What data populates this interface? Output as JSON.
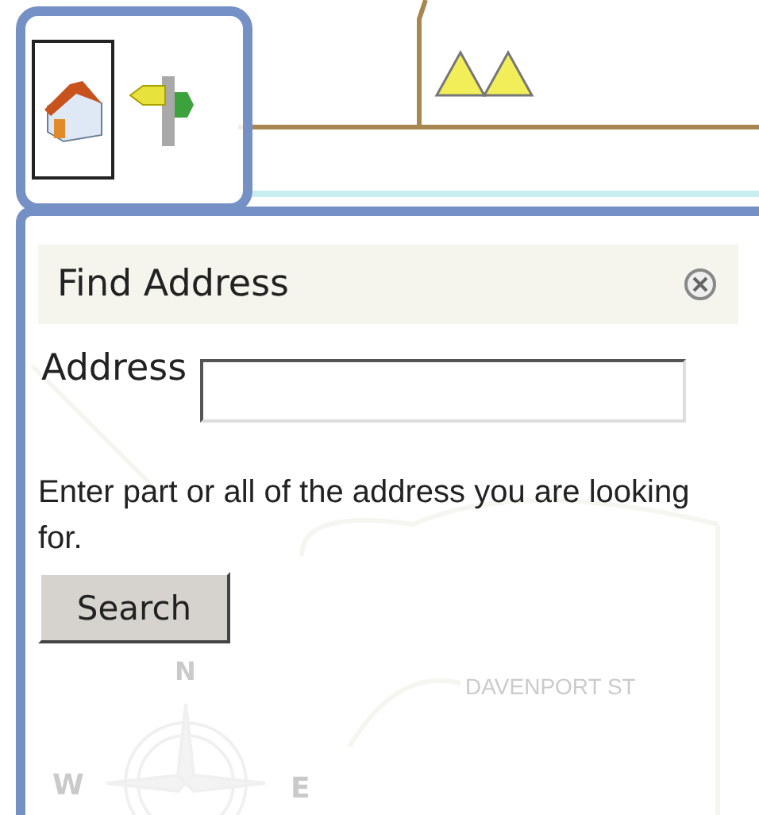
{
  "toolbar": {
    "tools": [
      {
        "kind": "home",
        "selected": true
      },
      {
        "kind": "signpost",
        "selected": false
      }
    ]
  },
  "map": {
    "street_label": "DAVENPORT ST",
    "compass": {
      "north": "N",
      "west": "W",
      "east": "E"
    }
  },
  "find_panel": {
    "title": "Find Address",
    "field_label": "Address",
    "hint": "Enter part or all of the address you are looking for.",
    "button": "Search"
  }
}
